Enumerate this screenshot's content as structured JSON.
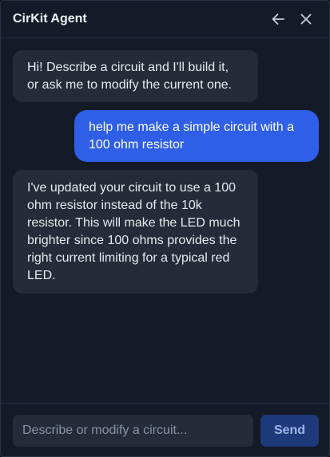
{
  "header": {
    "title": "CirKit Agent",
    "back_icon": "arrow-left-icon",
    "close_icon": "close-icon"
  },
  "messages": [
    {
      "role": "agent",
      "lines": [
        "Hi! Describe a circuit and I'll build it,",
        "or ask me to modify the current one."
      ]
    },
    {
      "role": "user",
      "lines": [
        "help me make a simple circuit with a",
        "100 ohm resistor"
      ]
    },
    {
      "role": "agent",
      "lines": [
        "I've updated your circuit to use a 100",
        "ohm resistor instead of the 10k",
        "resistor. This will make the LED much",
        "brighter since 100 ohms provides the",
        "right current limiting for a typical red",
        "LED."
      ]
    }
  ],
  "composer": {
    "placeholder": "Describe or modify a circuit...",
    "value": "",
    "send_label": "Send"
  },
  "colors": {
    "panel_background": "#141a27",
    "agent_bubble": "#252b38",
    "user_bubble": "#2f5fe6",
    "send_button": "#1e3a7a"
  }
}
